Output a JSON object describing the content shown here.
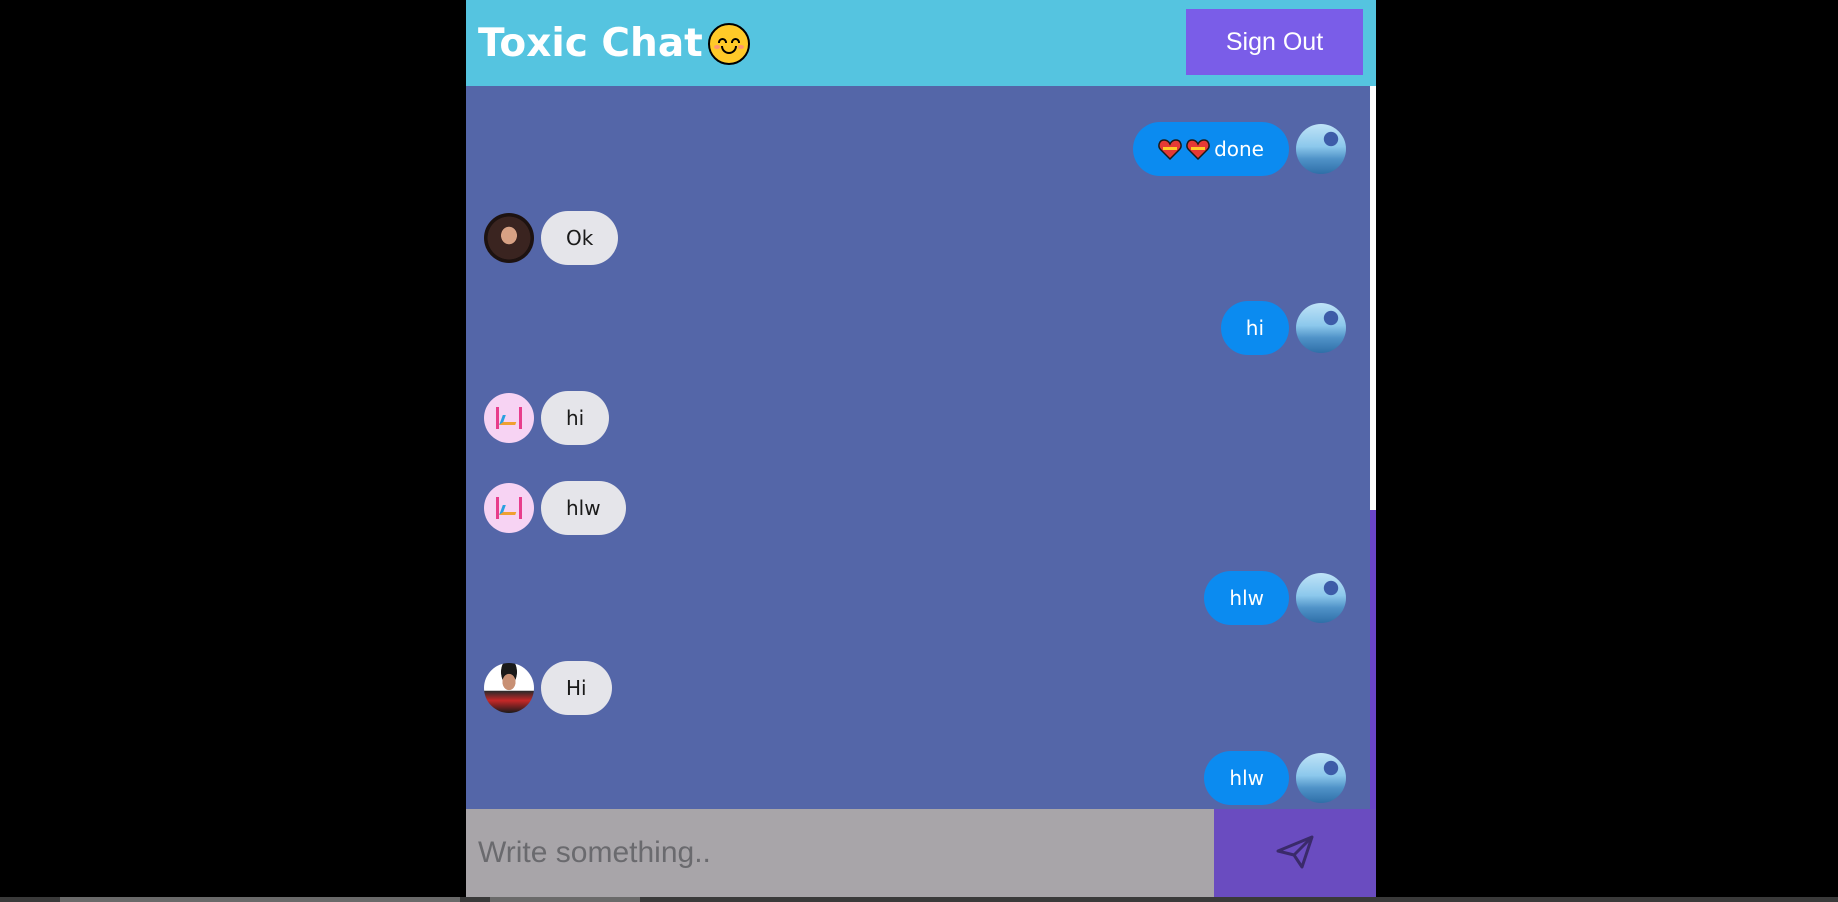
{
  "header": {
    "title": "Toxic Chat",
    "title_emoji": "smiling-face-icon",
    "sign_out_label": "Sign Out"
  },
  "colors": {
    "page_background": "#000000",
    "header": "#55c4e0",
    "chat_background": "#5466a8",
    "sign_out_button": "#7a5de8",
    "sent_bubble": "#0b8bf0",
    "received_bubble": "#e5e5ea",
    "input_background": "#a8a5a9",
    "send_button": "#6a4cc0"
  },
  "messages": [
    {
      "direction": "sent",
      "text": "done",
      "prefix_icons": [
        "heart-icon",
        "heart-icon"
      ],
      "avatar": "current-user-avatar"
    },
    {
      "direction": "received",
      "text": "Ok",
      "avatar": "user-avatar-woman"
    },
    {
      "direction": "sent",
      "text": "hi",
      "avatar": "current-user-avatar"
    },
    {
      "direction": "received",
      "text": "hi",
      "avatar": "user-avatar-logo"
    },
    {
      "direction": "received",
      "text": "hlw",
      "avatar": "user-avatar-logo"
    },
    {
      "direction": "sent",
      "text": "hlw",
      "avatar": "current-user-avatar"
    },
    {
      "direction": "received",
      "text": "Hi",
      "avatar": "user-avatar-man"
    },
    {
      "direction": "sent",
      "text": "hlw",
      "avatar": "current-user-avatar"
    }
  ],
  "composer": {
    "placeholder": "Write something..",
    "value": "",
    "send_icon": "paper-plane-icon"
  }
}
